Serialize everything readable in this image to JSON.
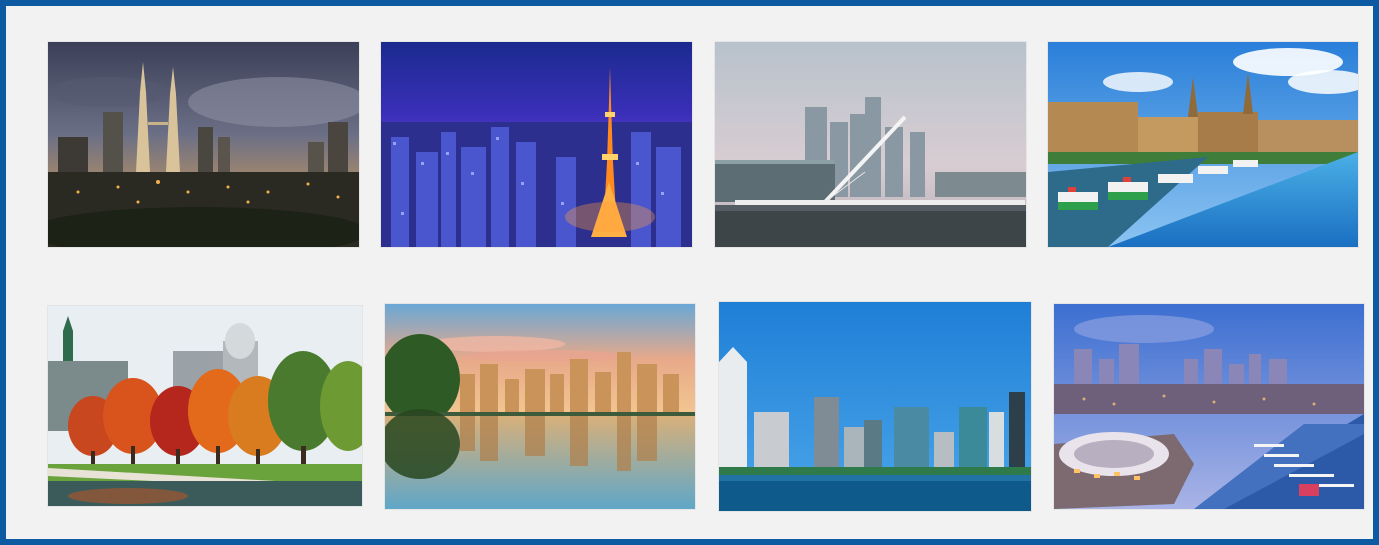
{
  "gallery": {
    "frame_color": "#0b5aa2",
    "background": "#f2f2f2",
    "tiles": [
      {
        "icon": "kuala-lumpur-skyline-dusk-image"
      },
      {
        "icon": "tokyo-tower-night-image"
      },
      {
        "icon": "buenos-aires-puerto-madero-bridge-image"
      },
      {
        "icon": "dresden-riverfront-image"
      },
      {
        "icon": "montreal-autumn-park-image"
      },
      {
        "icon": "vancouver-skyline-reflection-image"
      },
      {
        "icon": "san-diego-waterfront-skyline-image"
      },
      {
        "icon": "seattle-harbor-aerial-image"
      }
    ]
  }
}
